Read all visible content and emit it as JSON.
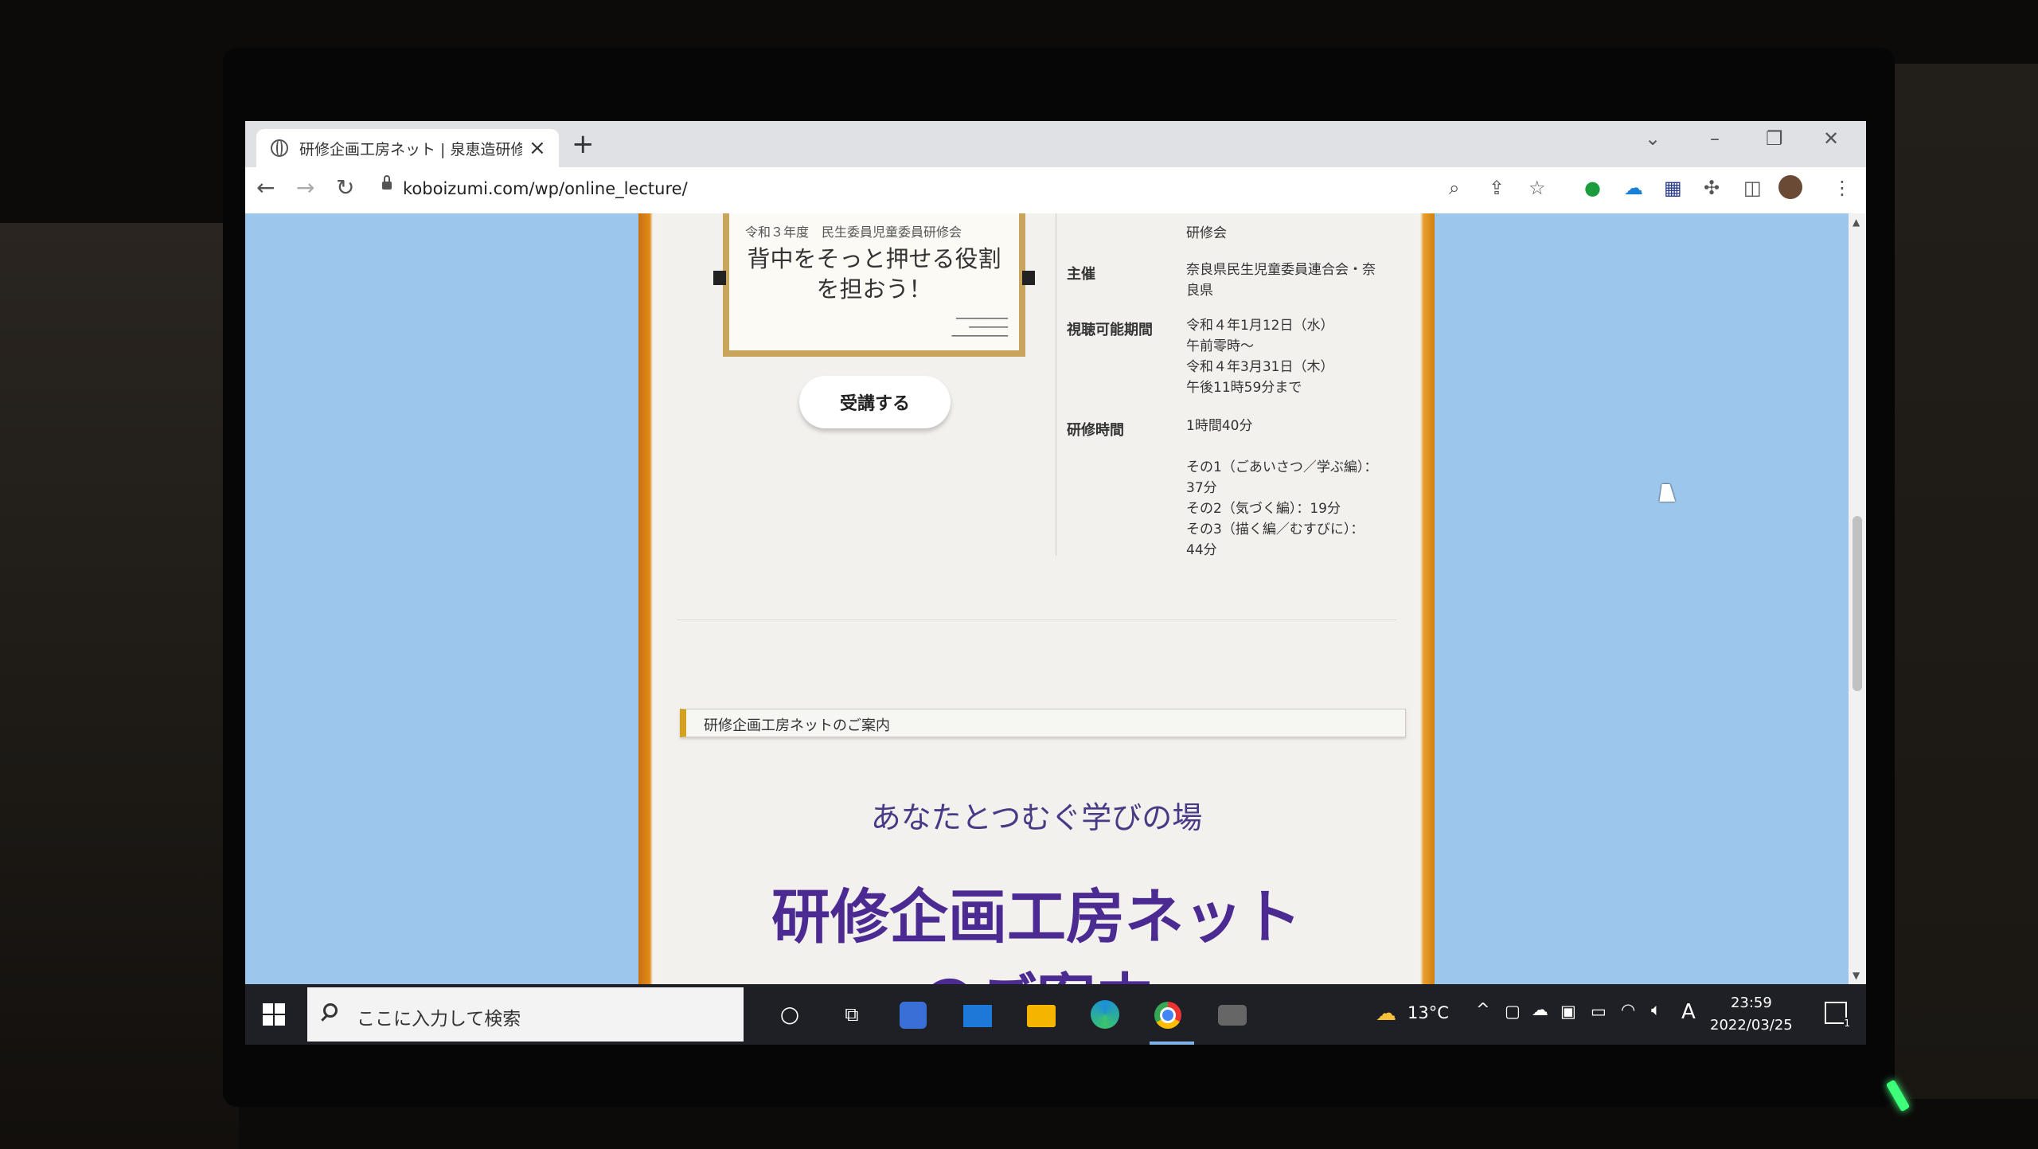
{
  "browser": {
    "tab_title": "研修企画工房ネット | 泉恵造研修企画",
    "url": "koboizumi.com/wp/online_lecture/"
  },
  "lecture": {
    "poster_header": "令和３年度　民生委員児童委員研修会",
    "poster_title_line1": "背中をそっと押せる役割",
    "poster_title_line2": "を担おう！",
    "enroll_button": "受講する",
    "rows": [
      {
        "label": "",
        "value": "研修会"
      },
      {
        "label": "主催",
        "value": "奈良県民生児童委員連合会・奈\n良県"
      },
      {
        "label": "視聴可能期間",
        "value": "令和４年1月12日（水）\n午前零時～\n令和４年3月31日（木）\n午後11時59分まで"
      },
      {
        "label": "研修時間",
        "value": "1時間40分\n\nその1（ごあいさつ／学ぶ編）：\n37分\nその2（気づく編）：19分\nその3（描く編／むすびに）：\n44分"
      }
    ]
  },
  "section": {
    "heading": "研修企画工房ネットのご案内",
    "tagline": "あなたとつむぐ学びの場",
    "title_line1": "研修企画工房ネット",
    "title_line2": "のご案内"
  },
  "taskbar": {
    "search_placeholder": "ここに入力して検索",
    "weather": "13°C",
    "ime": "A",
    "time": "23:59",
    "date": "2022/03/25",
    "notifications": "1"
  }
}
